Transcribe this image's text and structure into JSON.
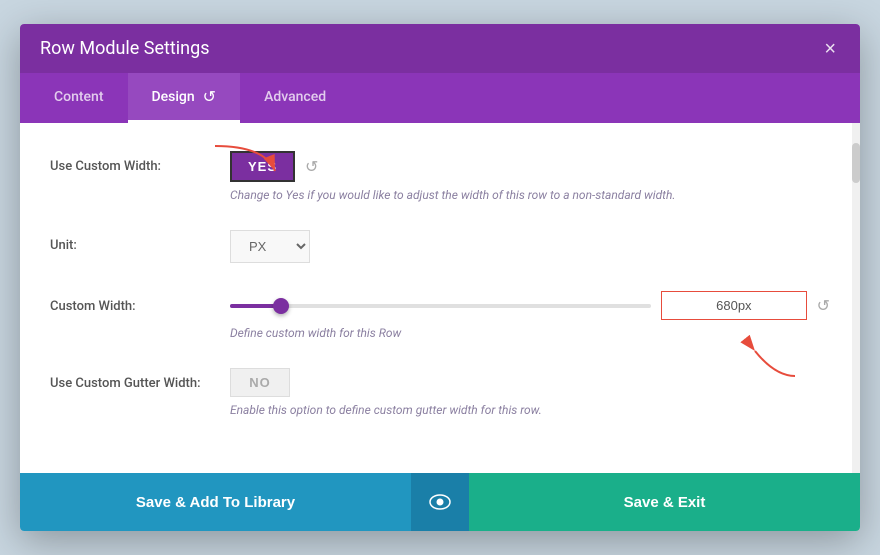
{
  "modal": {
    "title": "Row Module Settings",
    "close_label": "×"
  },
  "tabs": [
    {
      "id": "content",
      "label": "Content",
      "active": false
    },
    {
      "id": "design",
      "label": "Design",
      "active": true,
      "icon": "↺"
    },
    {
      "id": "advanced",
      "label": "Advanced",
      "active": false
    }
  ],
  "settings": {
    "use_custom_width": {
      "label": "Use Custom Width:",
      "value": "YES",
      "description": "Change to Yes if you would like to adjust the width of this row to a non-standard width."
    },
    "unit": {
      "label": "Unit:",
      "value": "PX"
    },
    "custom_width": {
      "label": "Custom Width:",
      "value": "680px",
      "description": "Define custom width for this Row"
    },
    "use_custom_gutter": {
      "label": "Use Custom Gutter Width:",
      "value": "NO",
      "description": "Enable this option to define custom gutter width for this row."
    }
  },
  "footer": {
    "save_library_label": "Save & Add To Library",
    "eye_icon": "👁",
    "save_exit_label": "Save & Exit"
  }
}
